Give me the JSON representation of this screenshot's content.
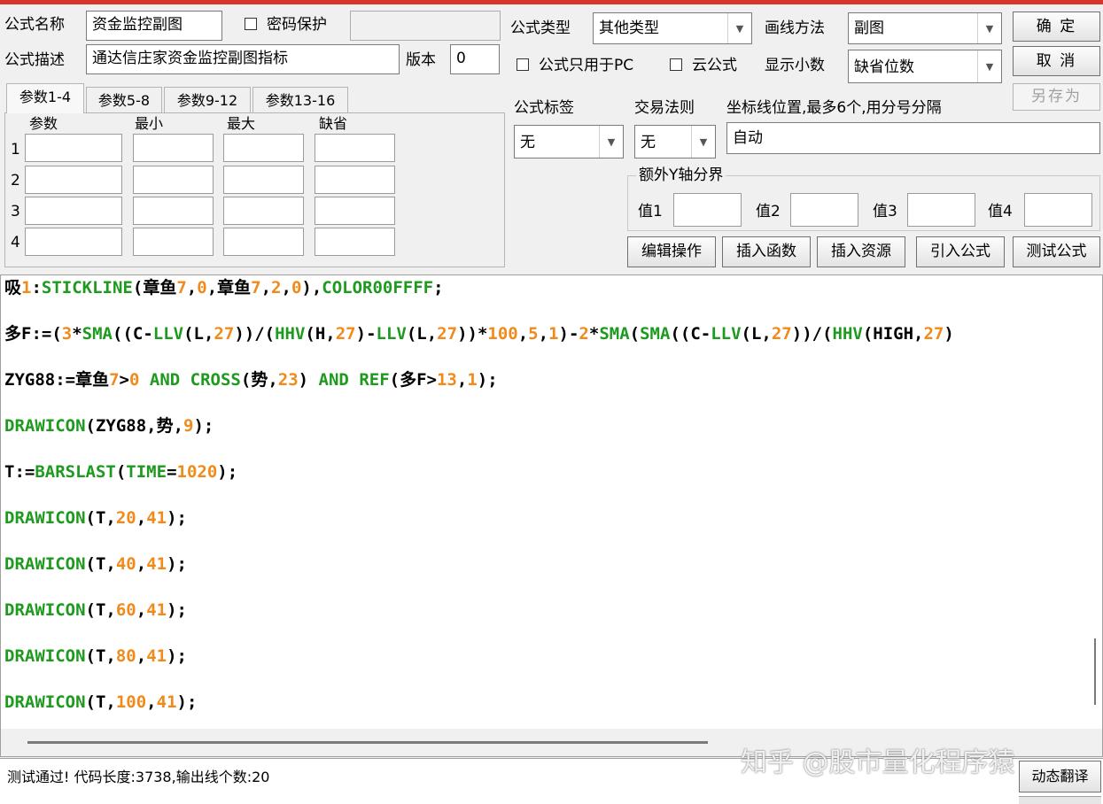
{
  "header": {
    "formula_name_label": "公式名称",
    "formula_name_value": "资金监控副图",
    "password_label": "密码保护",
    "formula_desc_label": "公式描述",
    "formula_desc_value": "通达信庄家资金监控副图指标",
    "version_label": "版本",
    "version_value": "0",
    "formula_type_label": "公式类型",
    "formula_type_value": "其他类型",
    "draw_method_label": "画线方法",
    "draw_method_value": "副图",
    "pc_only_label": "公式只用于PC",
    "cloud_label": "云公式",
    "decimals_label": "显示小数",
    "decimals_value": "缺省位数",
    "ok_button": "确 定",
    "cancel_button": "取 消",
    "save_as_button": "另存为"
  },
  "params": {
    "tabs": [
      "参数1-4",
      "参数5-8",
      "参数9-12",
      "参数13-16"
    ],
    "columns": [
      "参数",
      "最小",
      "最大",
      "缺省"
    ],
    "rows": [
      "1",
      "2",
      "3",
      "4"
    ]
  },
  "right_panel": {
    "tag_label": "公式标签",
    "tag_value": "无",
    "trade_rule_label": "交易法则",
    "trade_rule_value": "无",
    "axis_label": "坐标线位置,最多6个,用分号分隔",
    "axis_value": "自动",
    "extra_y_title": "额外Y轴分界",
    "value_labels": [
      "值1",
      "值2",
      "值3",
      "值4"
    ]
  },
  "actions": {
    "edit": "编辑操作",
    "insert_func": "插入函数",
    "insert_res": "插入资源",
    "import": "引入公式",
    "test": "测试公式"
  },
  "code": {
    "lines": [
      "吸1:STICKLINE(章鱼7,0,章鱼7,2,0),COLOR00FFFF;",
      "多F:=(3*SMA((C-LLV(L,27))/(HHV(H,27)-LLV(L,27))*100,5,1)-2*SMA(SMA((C-LLV(L,27))/(HHV(HIGH,27)",
      "ZYG88:=章鱼7>0 AND CROSS(势,23) AND REF(多F>13,1);",
      "DRAWICON(ZYG88,势,9);",
      "T:=BARSLAST(TIME=1020);",
      "DRAWICON(T,20,41);",
      "DRAWICON(T,40,41);",
      "DRAWICON(T,60,41);",
      "DRAWICON(T,80,41);",
      "DRAWICON(T,100,41);"
    ]
  },
  "status": {
    "message": "测试通过! 代码长度:3738,输出线个数:20",
    "dynamic_translate": "动态翻译"
  },
  "watermark": "知乎 @股市量化程序猿",
  "colors": {
    "function": "#1e9a1e",
    "number": "#f08a1a",
    "title_bar": "#d9342b"
  }
}
